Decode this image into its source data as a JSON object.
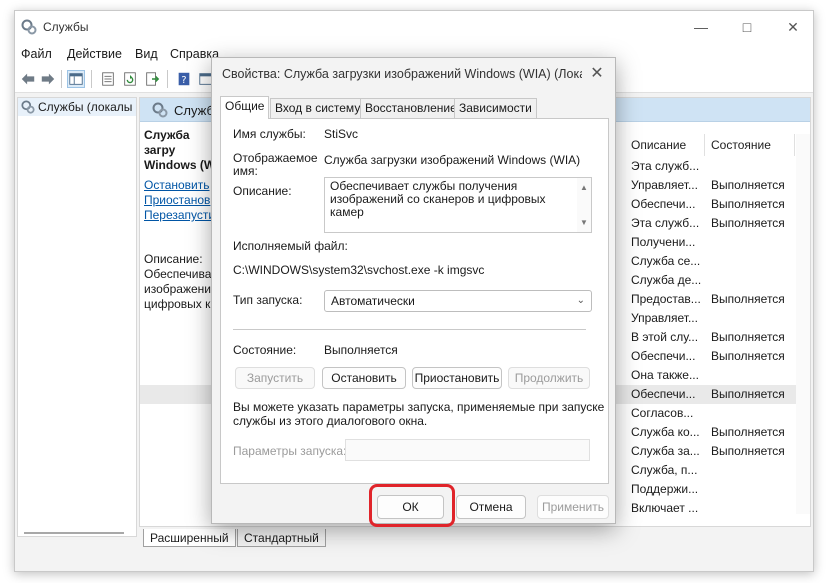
{
  "window": {
    "title": "Службы",
    "menu": [
      "Файл",
      "Действие",
      "Вид",
      "Справка"
    ],
    "left_tree_label": "Службы (локалы",
    "header_label": "Службы",
    "selected_service_title": "Служба загру Windows (W",
    "actions": [
      "Остановить",
      "Приостанов",
      "Перезапусти"
    ],
    "description_label": "Описание:",
    "description_text": [
      "Обеспечива",
      "изображени",
      "цифровых к"
    ],
    "columns": {
      "description": "Описание",
      "state": "Состояние"
    },
    "rows": [
      {
        "desc": "Эта служб...",
        "state": ""
      },
      {
        "desc": "Управляет...",
        "state": "Выполняется"
      },
      {
        "desc": "Обеспечи...",
        "state": "Выполняется"
      },
      {
        "desc": "Эта служб...",
        "state": "Выполняется"
      },
      {
        "desc": "Получени...",
        "state": ""
      },
      {
        "desc": "Служба се...",
        "state": ""
      },
      {
        "desc": "Служба де...",
        "state": ""
      },
      {
        "desc": "Предостав...",
        "state": "Выполняется"
      },
      {
        "desc": "Управляет...",
        "state": ""
      },
      {
        "desc": "В этой слу...",
        "state": "Выполняется"
      },
      {
        "desc": "Обеспечи...",
        "state": "Выполняется"
      },
      {
        "desc": "Она также...",
        "state": ""
      },
      {
        "desc": "Обеспечи...",
        "state": "Выполняется"
      },
      {
        "desc": "Согласов...",
        "state": ""
      },
      {
        "desc": "Служба ко...",
        "state": "Выполняется"
      },
      {
        "desc": "Служба за...",
        "state": "Выполняется"
      },
      {
        "desc": "Служба, п...",
        "state": ""
      },
      {
        "desc": "Поддержи...",
        "state": ""
      },
      {
        "desc": "Включает ...",
        "state": ""
      }
    ],
    "tabs": [
      "Расширенный",
      "Стандартный"
    ]
  },
  "dialog": {
    "title": "Свойства: Служба загрузки изображений Windows (WIA) (Локал...",
    "tabs": [
      "Общие",
      "Вход в систему",
      "Восстановление",
      "Зависимости"
    ],
    "service_name_label": "Имя службы:",
    "service_name_value": "StiSvc",
    "display_name_label_1": "Отображаемое",
    "display_name_label_2": "имя:",
    "display_name_value": "Служба загрузки изображений Windows (WIA)",
    "description_label": "Описание:",
    "description_value": "Обеспечивает службы получения изображений со сканеров и цифровых камер",
    "exe_label": "Исполняемый файл:",
    "exe_value": "C:\\WINDOWS\\system32\\svchost.exe -k imgsvc",
    "startup_type_label": "Тип запуска:",
    "startup_type_value": "Автоматически",
    "status_label": "Состояние:",
    "status_value": "Выполняется",
    "buttons": {
      "start": "Запустить",
      "stop": "Остановить",
      "pause": "Приостановить",
      "resume": "Продолжить",
      "ok": "ОК",
      "cancel": "Отмена",
      "apply": "Применить"
    },
    "hint_line_1": "Вы можете указать параметры запуска, применяемые при запуске",
    "hint_line_2": "службы из этого диалогового окна.",
    "params_label": "Параметры запуска:",
    "params_value": ""
  },
  "colors": {
    "highlight": "#e0242a",
    "header_bg": "#cfe3f4",
    "link": "#0055a5"
  },
  "icons": [
    "services-icon",
    "minimize-icon",
    "maximize-icon",
    "close-icon",
    "back-icon",
    "forward-icon",
    "console-icon",
    "properties-icon",
    "refresh-icon",
    "export-icon",
    "help-icon",
    "chevron-down-icon"
  ]
}
